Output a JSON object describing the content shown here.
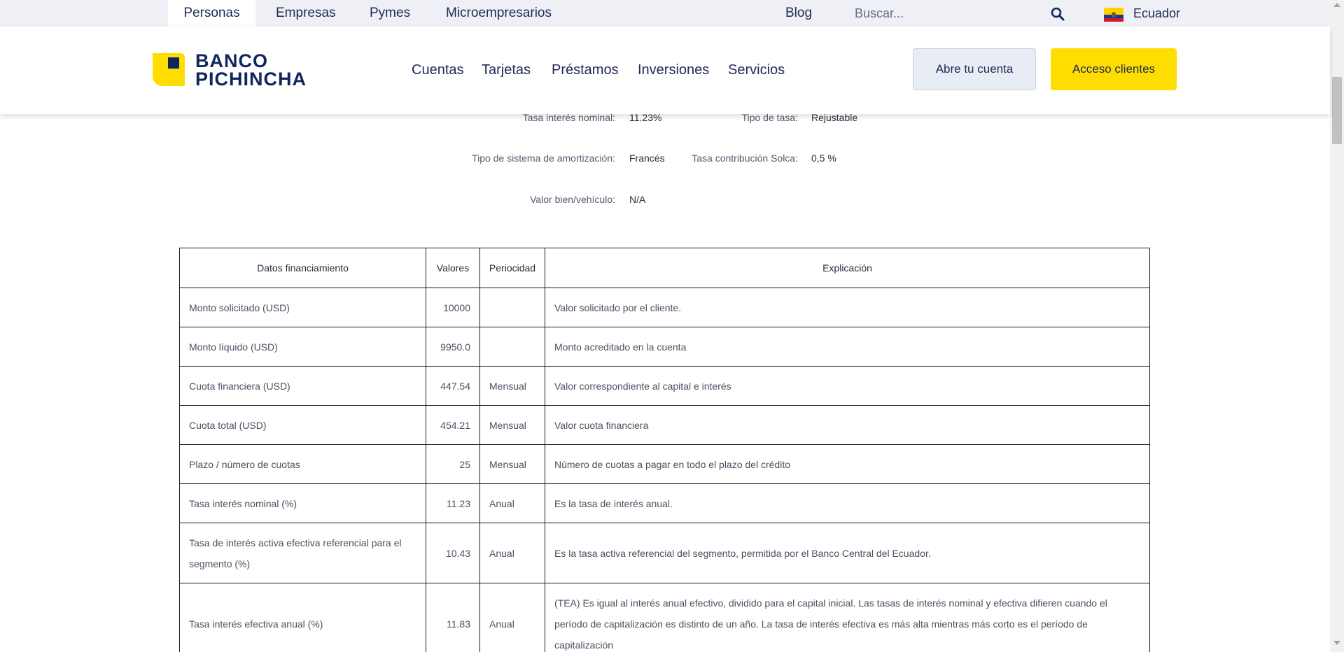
{
  "topbar": {
    "segments": [
      "Personas",
      "Empresas",
      "Pymes",
      "Microempresarios"
    ],
    "blog": "Blog",
    "search_placeholder": "Buscar...",
    "country": "Ecuador"
  },
  "header": {
    "logo_line1": "BANCO",
    "logo_line2": "PICHINCHA",
    "nav": [
      "Cuentas",
      "Tarjetas",
      "Préstamos",
      "Inversiones",
      "Servicios"
    ],
    "open_account_button": "Abre tu cuenta",
    "client_access_button": "Acceso clientes"
  },
  "summary": {
    "tasa_nominal_label": "Tasa interés nominal:",
    "tasa_nominal_value": "11.23%",
    "tipo_tasa_label": "Tipo de tasa:",
    "tipo_tasa_value": "Rejustable",
    "amortizacion_label": "Tipo de sistema de amortización:",
    "amortizacion_value": "Francés",
    "solca_label": "Tasa contribución Solca:",
    "solca_value": "0,5 %",
    "valor_bien_label": "Valor bien/vehículo:",
    "valor_bien_value": "N/A"
  },
  "table": {
    "headers": [
      "Datos financiamiento",
      "Valores",
      "Periocidad",
      "Explicación"
    ],
    "rows": [
      {
        "dato": "Monto solicitado (USD)",
        "valor": "10000",
        "periodicidad": "",
        "explicacion": "Valor solicitado por el cliente."
      },
      {
        "dato": "Monto líquido (USD)",
        "valor": "9950.0",
        "periodicidad": "",
        "explicacion": "Monto acreditado en la cuenta"
      },
      {
        "dato": "Cuota financiera (USD)",
        "valor": "447.54",
        "periodicidad": "Mensual",
        "explicacion": "Valor correspondiente al capital e interés"
      },
      {
        "dato": "Cuota total (USD)",
        "valor": "454.21",
        "periodicidad": "Mensual",
        "explicacion": "Valor cuota financiera"
      },
      {
        "dato": "Plazo / número de cuotas",
        "valor": "25",
        "periodicidad": "Mensual",
        "explicacion": "Número de cuotas a pagar en todo el plazo del crédito"
      },
      {
        "dato": "Tasa interés nominal (%)",
        "valor": "11.23",
        "periodicidad": "Anual",
        "explicacion": "Es la tasa de interés anual."
      },
      {
        "dato": "Tasa de interés activa efectiva referencial para el segmento (%)",
        "valor": "10.43",
        "periodicidad": "Anual",
        "explicacion": "Es la tasa activa referencial del segmento, permitida por el Banco Central del Ecuador."
      },
      {
        "dato": "Tasa interés efectiva anual (%)",
        "valor": "11.83",
        "periodicidad": "Anual",
        "explicacion": "(TEA) Es igual al interés anual efectivo, dividido para el capital inicial. Las tasas de interés nominal y efectiva difieren cuando el período de capitalización es distinto de un año. La tasa de interés efectiva es más alta mientras más corto es el período de capitalización"
      }
    ]
  }
}
